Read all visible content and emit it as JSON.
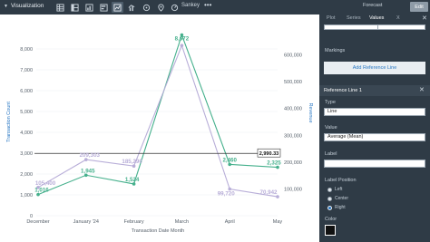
{
  "toolbar": {
    "title": "Visualization",
    "sankey_label": "Sankey",
    "more_label": "•••",
    "forecast_label": "Forecast",
    "edit_label": "Edit"
  },
  "panel": {
    "tabs": [
      "Plot",
      "Series",
      "Values",
      "X"
    ],
    "markings_label": "Markings",
    "add_reference_line": "Add Reference Line",
    "reference_line_title": "Reference Line 1",
    "type_label": "Type",
    "type_value": "Line",
    "value_label": "Value",
    "value_value": "Average (Mean)",
    "label_label": "Label",
    "label_value": "",
    "label_position_label": "Label Position",
    "positions": [
      "Left",
      "Center",
      "Right"
    ],
    "selected_position": "Right",
    "color_label": "Color",
    "color_value": "#111111"
  },
  "chart_data": {
    "type": "line",
    "categories": [
      "December",
      "January '24",
      "February",
      "March",
      "April",
      "May"
    ],
    "xlabel": "Transaction Date Month",
    "ylabel": "Transaction Count",
    "y2label": "Revenue",
    "ylim": [
      0,
      9000
    ],
    "y_ticks": [
      "0",
      "1,000",
      "2,000",
      "3,000",
      "4,000",
      "5,000",
      "6,000",
      "7,000",
      "8,000"
    ],
    "y2lim": [
      0,
      700000
    ],
    "y2_ticks": [
      "100,000",
      "200,000",
      "300,000",
      "400,000",
      "500,000",
      "600,000"
    ],
    "series": [
      {
        "axis": "left",
        "color": "#45b08c",
        "values": [
          1016,
          1945,
          1524,
          8672,
          2460,
          2325
        ],
        "labels": [
          "1,016",
          "1,945",
          "1,524",
          "8,672",
          "2,460",
          "2,325"
        ]
      },
      {
        "axis": "right",
        "color": "#b8aed8",
        "values": [
          105400,
          209300,
          185300,
          635000,
          99720,
          70942
        ],
        "labels": [
          "105,400",
          "209,303",
          "185,290",
          "",
          "99,720",
          "70,942"
        ]
      }
    ],
    "reference_line": {
      "value": 2990.33,
      "label": "2,990.33",
      "color": "#333333"
    }
  }
}
